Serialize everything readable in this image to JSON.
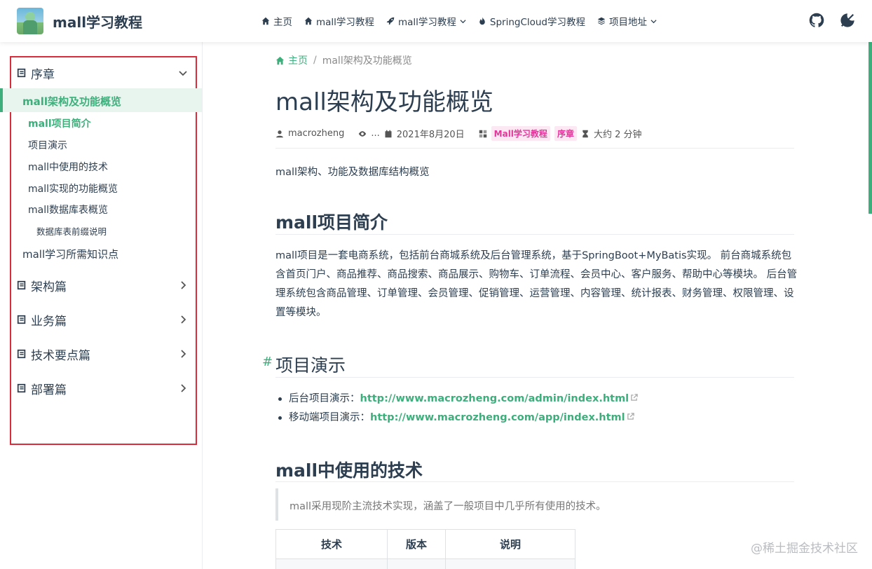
{
  "navbar": {
    "site_name": "mall学习教程",
    "links": [
      {
        "label": "主页",
        "icon": "home-icon"
      },
      {
        "label": "mall学习教程",
        "icon": "home-icon"
      },
      {
        "label": "mall学习教程",
        "icon": "rocket-icon",
        "dropdown": true
      },
      {
        "label": "SpringCloud学习教程",
        "icon": "fire-icon"
      },
      {
        "label": "项目地址",
        "icon": "layers-icon",
        "dropdown": true
      }
    ],
    "right_icons": [
      "github-icon",
      "theme-toggle-icon"
    ]
  },
  "sidebar": {
    "groups": [
      "序章",
      "架构篇",
      "业务篇",
      "技术要点篇",
      "部署篇"
    ],
    "active_item": "mall架构及功能概览",
    "sub_items": [
      "mall项目简介",
      "项目演示",
      "mall中使用的技术",
      "mall实现的功能概览",
      "mall数据库表概览"
    ],
    "sub_sub_item": "数据库表前缀说明",
    "extra_item": "mall学习所需知识点"
  },
  "breadcrumb": {
    "home": "主页",
    "separator": "/",
    "current": "mall架构及功能概览"
  },
  "article": {
    "title": "mall架构及功能概览",
    "author": "macrozheng",
    "views": "...",
    "date": "2021年8月20日",
    "tags": [
      "Mall学习教程",
      "序章"
    ],
    "reading_time": "大约 2 分钟",
    "description": "mall架构、功能及数据库结构概览",
    "sections": {
      "intro_heading": "mall项目简介",
      "intro_text": "mall项目是一套电商系统，包括前台商城系统及后台管理系统，基于SpringBoot+MyBatis实现。 前台商城系统包含首页门户、商品推荐、商品搜索、商品展示、购物车、订单流程、会员中心、客户服务、帮助中心等模块。 后台管理系统包含商品管理、订单管理、会员管理、促销管理、运营管理、内容管理、统计报表、财务管理、权限管理、设置等模块。",
      "demo_anchor": "#",
      "demo_heading": "项目演示",
      "demo_items": [
        {
          "label": "后台项目演示：",
          "link": "http://www.macrozheng.com/admin/index.html"
        },
        {
          "label": "移动端项目演示：",
          "link": "http://www.macrozheng.com/app/index.html"
        }
      ],
      "tech_heading": "mall中使用的技术",
      "tech_quote": "mall采用现阶主流技术实现，涵盖了一般项目中几乎所有使用的技术。",
      "tech_table_headers": [
        "技术",
        "版本",
        "说明"
      ]
    }
  },
  "watermark": "@稀土掘金技术社区",
  "colors": {
    "accent": "#3eaf7c",
    "tag": "#e0389a",
    "highlight_box": "#d92c3a"
  }
}
